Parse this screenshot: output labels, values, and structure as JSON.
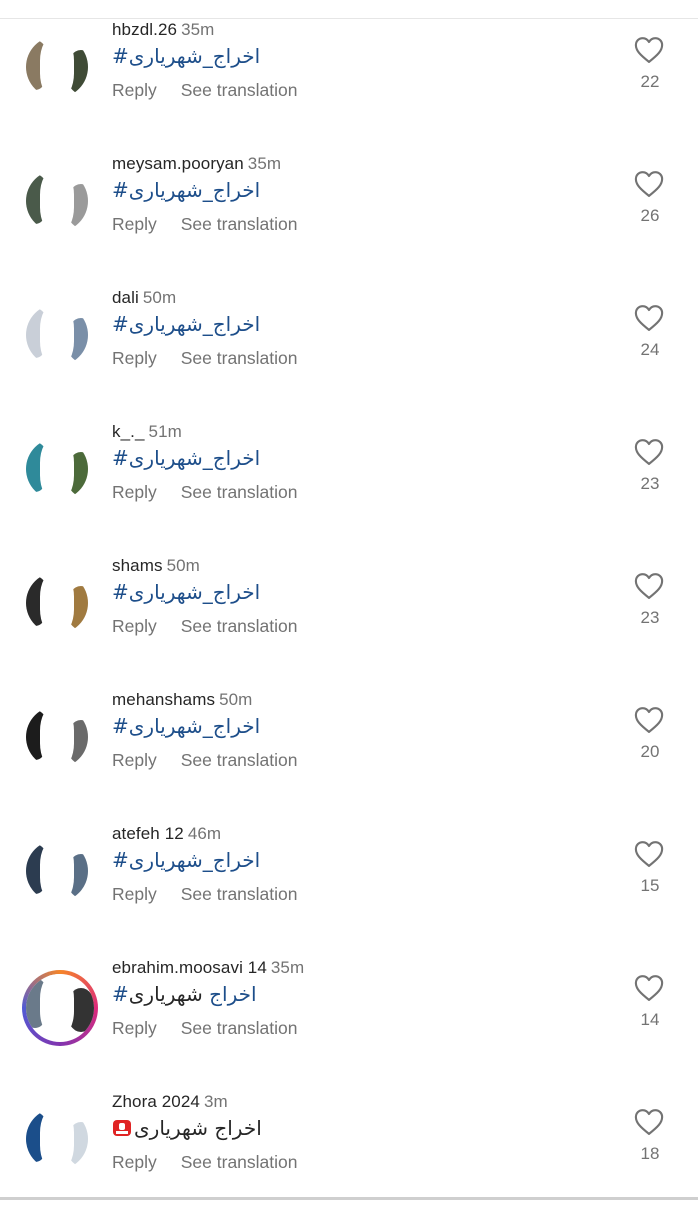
{
  "comments": [
    {
      "username": "hbzdl.26",
      "time": "35m",
      "prefix": "",
      "hash": "#اخراج_شهریاری",
      "suffix": "",
      "likes": "22",
      "reply": "Reply",
      "translate": "See translation",
      "avatar": {
        "ring": false,
        "c1": "#8a7a62",
        "c2": "#3f4b36"
      }
    },
    {
      "username": "meysam.pooryan",
      "time": "35m",
      "prefix": "",
      "hash": "#اخراج_شهریاری",
      "suffix": "",
      "likes": "26",
      "reply": "Reply",
      "translate": "See translation",
      "avatar": {
        "ring": false,
        "c1": "#4a5a4a",
        "c2": "#9a9a9a"
      }
    },
    {
      "username": "dali",
      "time": "50m",
      "prefix": "",
      "hash": "#اخراج_شهریاری",
      "suffix": "",
      "likes": "24",
      "reply": "Reply",
      "translate": "See translation",
      "avatar": {
        "ring": false,
        "c1": "#c9cfd8",
        "c2": "#7a8fa8"
      }
    },
    {
      "username": "k_._",
      "time": "51m",
      "prefix": "",
      "hash": "#اخراج_شهریاری",
      "suffix": "",
      "likes": "23",
      "reply": "Reply",
      "translate": "See translation",
      "avatar": {
        "ring": false,
        "c1": "#2f8a9a",
        "c2": "#4c6a3a"
      }
    },
    {
      "username": "shams",
      "time": "50m",
      "prefix": "",
      "hash": "#اخراج_شهریاری",
      "suffix": "",
      "likes": "23",
      "reply": "Reply",
      "translate": "See translation",
      "avatar": {
        "ring": false,
        "c1": "#2a2a2a",
        "c2": "#a07a40"
      }
    },
    {
      "username": "mehanshams",
      "time": "50m",
      "prefix": "",
      "hash": "#اخراج_شهریاری",
      "suffix": "",
      "likes": "20",
      "reply": "Reply",
      "translate": "See translation",
      "avatar": {
        "ring": false,
        "c1": "#1c1c1c",
        "c2": "#6a6a6a"
      }
    },
    {
      "username": "atefeh 12",
      "time": "46m",
      "prefix": "",
      "hash": "#اخراج_شهریاری",
      "suffix": "",
      "likes": "15",
      "reply": "Reply",
      "translate": "See translation",
      "avatar": {
        "ring": false,
        "c1": "#2c3c50",
        "c2": "#5a6f86"
      }
    },
    {
      "username": "ebrahim.moosavi 14",
      "time": "35m",
      "prefix": "",
      "hash": "#اخراج",
      "suffix": " شهریاری",
      "likes": "14",
      "reply": "Reply",
      "translate": "See translation",
      "avatar": {
        "ring": true,
        "c1": "#6a7a8a",
        "c2": "#333333"
      }
    },
    {
      "username": "Zhora 2024",
      "time": "3m",
      "prefix": "",
      "hash": "",
      "suffix": "اخراج شهریاری",
      "siren": true,
      "likes": "18",
      "reply": "Reply",
      "translate": "See translation",
      "avatar": {
        "ring": false,
        "c1": "#1b4e8a",
        "c2": "#d0d8e0"
      }
    }
  ],
  "colors": {
    "hashtag": "#1d4e8a",
    "meta": "#737373",
    "name": "#262626"
  },
  "icons": {
    "like": "heart-outline-icon",
    "siren": "siren-emoji-icon"
  }
}
